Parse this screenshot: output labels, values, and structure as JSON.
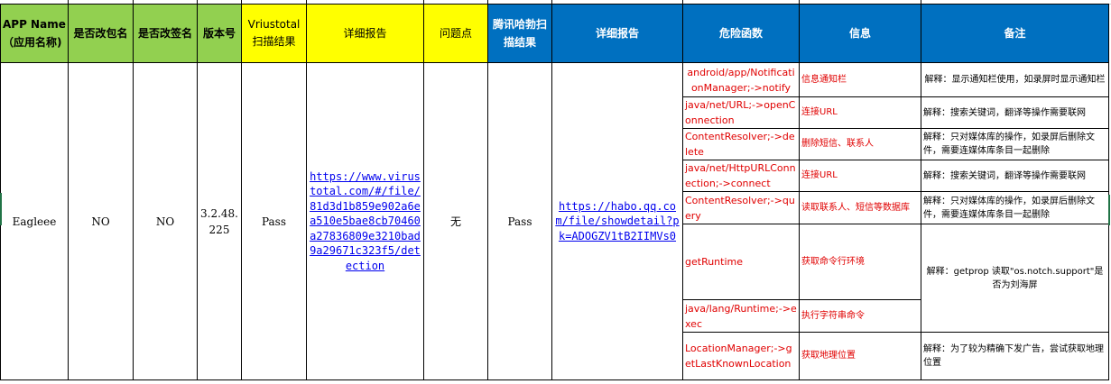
{
  "headers": {
    "app_name": "APP Name（应用名称)",
    "package_changed": "是否改包名",
    "signature_changed": "是否改签名",
    "version": "版本号",
    "virustotal": "Vriustotal扫描结果",
    "virustotal_report": "详细报告",
    "issue": "问题点",
    "tencent": "腾讯哈勃扫描结果",
    "tencent_report": "详细报告",
    "danger_func": "危险函数",
    "info": "信息",
    "remark": "备注"
  },
  "row": {
    "app_name": "Eagleee",
    "package_changed": "NO",
    "signature_changed": "NO",
    "version": "3.2.48.225",
    "virustotal": "Pass",
    "virustotal_report": "https://www.virustotal.com/#/file/81d3d1b859e902a6ea510e5bae8cb70460a27836809e3210bad9a29671c323f5/detection",
    "issue": "无",
    "tencent": "Pass",
    "tencent_report": "https://habo.qq.com/file/showdetail?pk=ADOGZV1tB2IIMVs0"
  },
  "details": [
    {
      "func": "android/app/NotificationManager;->notify",
      "info": "信息通知栏",
      "note": "解释：显示通知栏使用，如录屏时显示通知栏"
    },
    {
      "func": "java/net/URL;->openConnection",
      "info": "连接URL",
      "note": "解释：搜索关键词，翻译等操作需要联网"
    },
    {
      "func": "ContentResolver;->delete",
      "info": "删除短信、联系人",
      "note": "解释：只对媒体库的操作，如录屏后删除文件，需要连媒体库条目一起删除"
    },
    {
      "func": "java/net/HttpURLConnection;->connect",
      "info": "连接URL",
      "note": "解释：搜索关键词，翻译等操作需要联网"
    },
    {
      "func": "ContentResolver;->query",
      "info": "读取联系人、短信等数据库",
      "note": "解释：只对媒体库的操作，如录屏后删除文件，需要连媒体库条目一起删除"
    },
    {
      "func": "getRuntime",
      "info": "获取命令行环境",
      "note": "解释：getprop 读取\"os.notch.support\"是否为刘海屏"
    },
    {
      "func": "java/lang/Runtime;->exec",
      "info": "执行字符串命令"
    },
    {
      "func": "LocationManager;->getLastKnownLocation",
      "info": "获取地理位置",
      "note": "解释：为了较为精确下发广告，尝试获取地理位置"
    }
  ],
  "colors": {
    "header_green": "#92d050",
    "header_yellow": "#ffff00",
    "header_blue": "#0070c0",
    "func_red": "#e00000",
    "link_blue": "#0000ee"
  }
}
